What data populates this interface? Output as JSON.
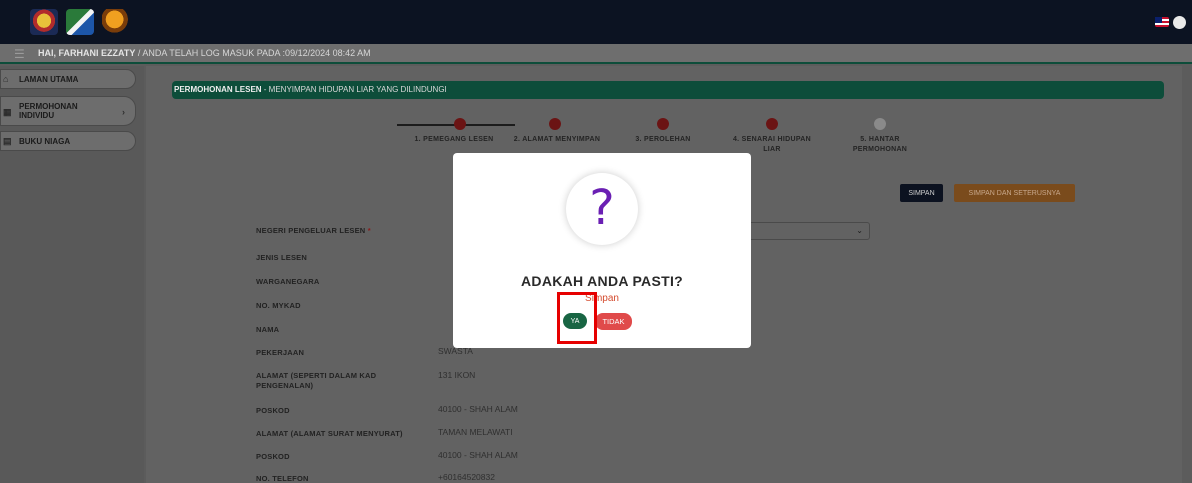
{
  "header": {
    "logos": [
      "jata-negara-logo",
      "perhilitan-logo",
      "tiger-logo"
    ],
    "right_icons": [
      "malaysia-flag-icon",
      "user-icon"
    ]
  },
  "subbar": {
    "greeting": "HAI, FARHANI EZZATY",
    "login_info": " / ANDA TELAH LOG MASUK PADA :09/12/2024 08:42 AM"
  },
  "sidebar": {
    "items": [
      {
        "label": "LAMAN UTAMA",
        "icon": "home-icon"
      },
      {
        "label_line1": "PERMOHONAN",
        "label_line2": "INDIVIDU",
        "icon": "grid-icon",
        "chevron": "›"
      },
      {
        "label": "BUKU NIAGA",
        "icon": "book-icon"
      }
    ]
  },
  "page": {
    "title_bold": "PERMOHONAN LESEN",
    "title_rest": " - MENYIMPAN HIDUPAN LIAR YANG DILINDUNGI"
  },
  "stepper": {
    "steps": [
      {
        "line1": "1. PEMEGANG LESEN",
        "line2": ""
      },
      {
        "line1": "2. ALAMAT MENYIMPAN",
        "line2": ""
      },
      {
        "line1": "3. PEROLEHAN",
        "line2": ""
      },
      {
        "line1": "4. SENARAI HIDUPAN",
        "line2": "LIAR"
      },
      {
        "line1": "5. HANTAR",
        "line2": "PERMOHONAN"
      }
    ]
  },
  "actions": {
    "save": "SIMPAN",
    "save_next": "SIMPAN DAN SETERUSNYA"
  },
  "form": {
    "fields": [
      {
        "label": "NEGERI PENGELUAR LESEN",
        "required": "*",
        "value": ""
      },
      {
        "label": "JENIS LESEN",
        "value": ""
      },
      {
        "label": "WARGANEGARA",
        "value": ""
      },
      {
        "label": "NO. MYKAD",
        "value": ""
      },
      {
        "label": "NAMA",
        "value": ""
      },
      {
        "label": "PEKERJAAN",
        "value": "SWASTA"
      },
      {
        "label_line1": "ALAMAT (SEPERTI DALAM KAD",
        "label_line2": "PENGENALAN)",
        "value": "131 IKON"
      },
      {
        "label": "POSKOD",
        "value": "40100 - SHAH ALAM"
      },
      {
        "label": "ALAMAT (ALAMAT SURAT MENYURAT)",
        "value": "TAMAN MELAWATI"
      },
      {
        "label": "POSKOD",
        "value": "40100 - SHAH ALAM"
      },
      {
        "label": "NO. TELEFON",
        "value": "+60164520832"
      }
    ]
  },
  "modal": {
    "icon": "?",
    "title": "ADAKAH ANDA PASTI?",
    "subtitle": "Simpan",
    "confirm": "YA",
    "cancel": "TIDAK"
  },
  "colors": {
    "accent_green": "#186543",
    "danger_red": "#e04a4a",
    "header_navy": "#0c1322",
    "highlight_red": "#e60000"
  }
}
